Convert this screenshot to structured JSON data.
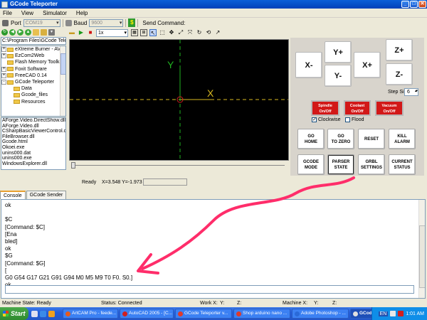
{
  "window": {
    "title": "GCode Teleporter"
  },
  "menu": [
    "File",
    "View",
    "Simulator",
    "Help"
  ],
  "connection": {
    "port_label": "Port",
    "port_value": "COM19",
    "baud_label": "Baud",
    "baud_value": "9600",
    "send_label": "Send Command:"
  },
  "file_browser": {
    "path": "C:\\Program Files\\GCode Tele",
    "tree": [
      {
        "label": "eXtreme Burner - AVR",
        "exp": "+"
      },
      {
        "label": "EzCom2Web",
        "exp": "+"
      },
      {
        "label": "Flash Memory Toolkit",
        "exp": ""
      },
      {
        "label": "Foxit Software",
        "exp": "+"
      },
      {
        "label": "FreeCAD 0.14",
        "exp": "+"
      },
      {
        "label": "GCode Teleporter",
        "exp": "-"
      },
      {
        "label": "Data",
        "exp": ""
      },
      {
        "label": "Gcode_files",
        "exp": ""
      },
      {
        "label": "Resources",
        "exp": ""
      }
    ],
    "files": [
      "AForge.Video.DirectShow.dll",
      "AForge.Video.dll",
      "CSharpBasicViewerControl.dll",
      "FileBrowser.dll",
      "Gcode.html",
      "Okoei.exe",
      "unins000.dat",
      "unins000.exe",
      "WindowsExplorer.dll"
    ]
  },
  "viewer": {
    "speed": "1x",
    "axis_x": "X",
    "axis_y": "Y",
    "status_ready": "Ready",
    "status_coords": "X=3.548 Y=-1.973"
  },
  "jog": {
    "x_minus": "X-",
    "x_plus": "X+",
    "y_plus": "Y+",
    "y_minus": "Y-",
    "z_plus": "Z+",
    "z_minus": "Z-",
    "step_label": "Step Size:",
    "step_value": "6",
    "spindle": "Spindle On/Off",
    "coolant": "Coolant On/Off",
    "vacuum": "Vacuum On/Off",
    "clockwise": "Clockwise",
    "flood": "Flood",
    "go_home": "GO HOME",
    "go_zero": "GO TO ZERO",
    "reset": "RESET",
    "kill_alarm": "KILL ALARM",
    "gcode_mode": "GCODE MODE",
    "parser_state": "PARSER STATE",
    "grbl_settings": "GRBL SETTINGS",
    "current_status": "CURRENT STATUS"
  },
  "tabs": [
    "Console",
    "GCode Sender"
  ],
  "console_lines": [
    "ok",
    "",
    "$C",
    "[Command: $C]",
    "[Ena",
    "bled]",
    "ok",
    "$G",
    "[Command: $G]",
    "[",
    "G0 G54 G17 G21 G91 G94 M0 M5 M9 T0 F0. S0.]",
    "ok"
  ],
  "status": {
    "machine_state": "Machine State: Ready",
    "connection": "Status: Connected",
    "work_x": "Work X:",
    "work_y": "Y:",
    "work_z": "Z:",
    "machine_x": "Machine X:",
    "machine_y": "Y:",
    "machine_z": "Z:"
  },
  "taskbar": {
    "start": "Start",
    "tasks": [
      {
        "label": "ArtCAM Pro - feede...",
        "color": "#e85a1a"
      },
      {
        "label": "AutoCAD 2005 - [C...",
        "color": "#d02020"
      },
      {
        "label": "GCode Teleporter v...",
        "color": "#e03a2a"
      },
      {
        "label": "Shop arduino nano ...",
        "color": "#e03a2a"
      },
      {
        "label": "Adobe Photoshop - ...",
        "color": "#2a6ad8"
      },
      {
        "label": "GCode Teleporter",
        "color": "#e0e0e0"
      }
    ],
    "lang": "EN",
    "clock": "1:01 AM"
  },
  "annotation": {
    "arrow_color": "#ff2d6a"
  }
}
